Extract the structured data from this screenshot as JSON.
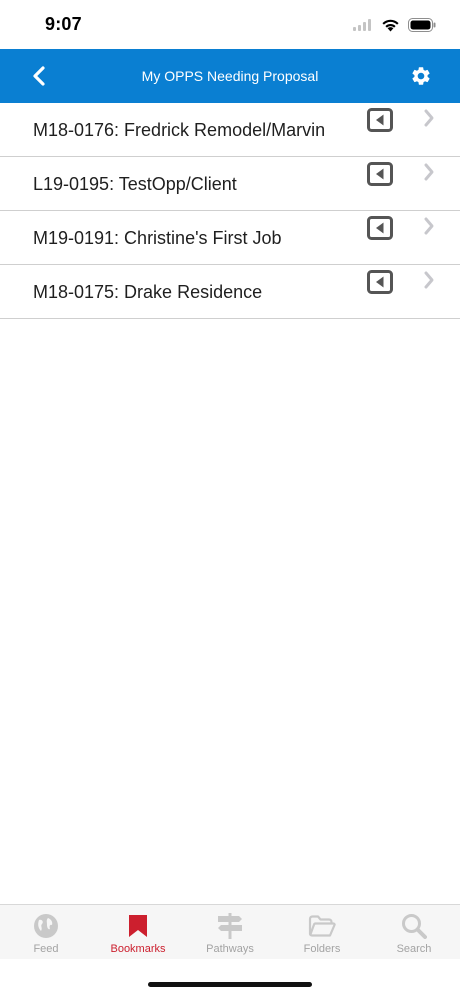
{
  "status_bar": {
    "time": "9:07"
  },
  "nav": {
    "title": "My OPPS Needing Proposal",
    "back_icon": "chevron-left-icon",
    "settings_icon": "gear-icon",
    "background": "#0a7fd2"
  },
  "list": {
    "items": [
      {
        "label": "M18-0176: Fredrick Remodel/Marvin"
      },
      {
        "label": "L19-0195: TestOpp/Client"
      },
      {
        "label": "M19-0191: Christine's First Job"
      },
      {
        "label": "M18-0175: Drake Residence"
      }
    ]
  },
  "tabs": [
    {
      "label": "Feed",
      "icon": "globe-icon",
      "active": false
    },
    {
      "label": "Bookmarks",
      "icon": "bookmark-icon",
      "active": true
    },
    {
      "label": "Pathways",
      "icon": "signpost-icon",
      "active": false
    },
    {
      "label": "Folders",
      "icon": "folder-icon",
      "active": false
    },
    {
      "label": "Search",
      "icon": "search-icon",
      "active": false
    }
  ],
  "colors": {
    "accent": "#0a7fd2",
    "active_tab": "#cc1f2e",
    "inactive_tab": "#a3a3a3"
  }
}
